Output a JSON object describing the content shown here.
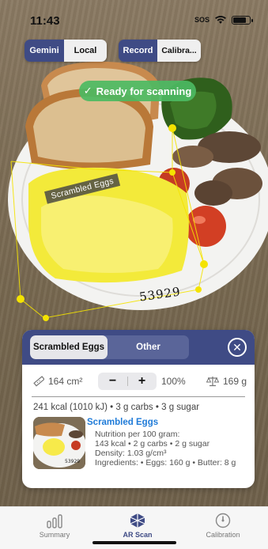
{
  "status_bar": {
    "time": "11:43",
    "sos": "SOS"
  },
  "top_controls": {
    "mode_options": [
      "Gemini",
      "Local"
    ],
    "record_label": "Record",
    "calibrate_label": "Calibra..."
  },
  "scanner": {
    "ready_text": "Ready for scanning",
    "food_tag": "Scrambled Eggs",
    "plate_number": "53929"
  },
  "panel": {
    "food_tabs": [
      "Scrambled Eggs",
      "Other"
    ],
    "area": "164 cm²",
    "portion_percent": "100%",
    "weight": "169 g",
    "summary": "241 kcal (1010 kJ) • 3 g carbs • 3 g sugar",
    "food_name": "Scrambled Eggs",
    "info_lines": [
      "Nutrition per 100 gram:",
      "143 kcal • 2 g carbs • 2 g sugar",
      "Density: 1.03 g/cm³",
      "Ingredients: • Eggs: 160 g • Butter: 8 g"
    ]
  },
  "tabs": [
    {
      "label": "Summary",
      "icon": "bar-chart-icon"
    },
    {
      "label": "AR Scan",
      "icon": "ar-cube-icon"
    },
    {
      "label": "Calibration",
      "icon": "gauge-icon"
    }
  ],
  "colors": {
    "accent": "#3f4b85",
    "ready": "#4cba62",
    "link": "#1f7bd8",
    "scan_overlay": "#f4e300"
  }
}
